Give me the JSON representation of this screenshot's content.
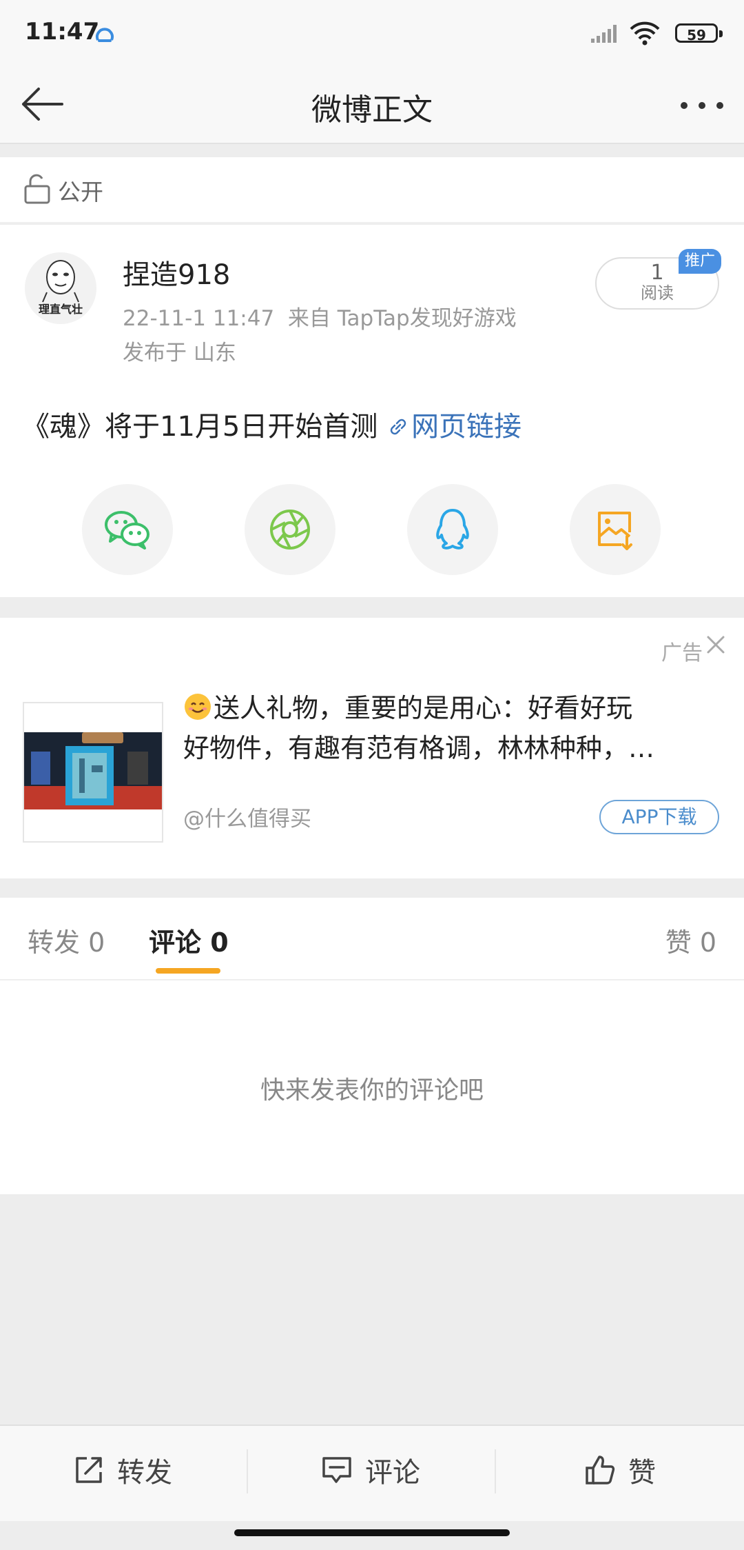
{
  "status_bar": {
    "time": "11:47",
    "battery": "59"
  },
  "nav": {
    "title": "微博正文"
  },
  "post": {
    "visibility": "公开",
    "author": "捏造918",
    "avatar_caption": "理直气壮",
    "meta": "22-11-1 11:47  来自 TapTap发现好游戏",
    "location": "发布于 山东",
    "read_count": "1",
    "read_label": "阅读",
    "promo_badge": "推广",
    "text": "《魂》将于11月5日开始首测 ",
    "link_text": "网页链接",
    "share_targets": [
      "wechat-icon",
      "moments-icon",
      "qq-icon",
      "save-image-icon"
    ]
  },
  "ad": {
    "tag": "广告",
    "line1": "送人礼物，重要的是用心：好看好玩",
    "line2": "好物件，有趣有范有格调，林林种种，…",
    "source": "@什么值得买",
    "button": "APP下载"
  },
  "tabs": {
    "repost": "转发 0",
    "comment": "评论 0",
    "like": "赞 0"
  },
  "comments": {
    "empty": "快来发表你的评论吧"
  },
  "bottom_bar": {
    "repost": "转发",
    "comment": "评论",
    "like": "赞"
  }
}
